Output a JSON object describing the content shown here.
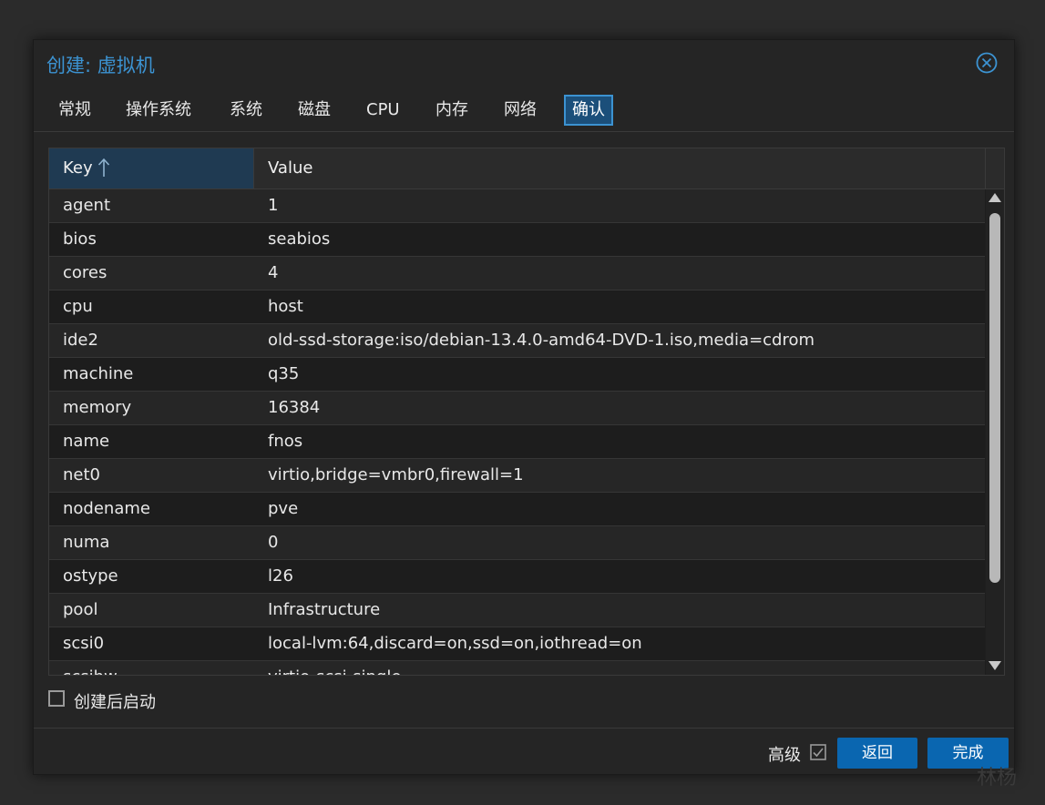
{
  "dialog": {
    "title": "创建: 虚拟机"
  },
  "tabs": [
    {
      "label": "常规"
    },
    {
      "label": "操作系统"
    },
    {
      "label": "系统"
    },
    {
      "label": "磁盘"
    },
    {
      "label": "CPU"
    },
    {
      "label": "内存"
    },
    {
      "label": "网络"
    },
    {
      "label": "确认",
      "active": true
    }
  ],
  "grid": {
    "columns": {
      "key": "Key",
      "value": "Value"
    },
    "sort": "ascending",
    "rows": [
      {
        "key": "agent",
        "value": "1"
      },
      {
        "key": "bios",
        "value": "seabios"
      },
      {
        "key": "cores",
        "value": "4"
      },
      {
        "key": "cpu",
        "value": "host"
      },
      {
        "key": "ide2",
        "value": "old-ssd-storage:iso/debian-13.4.0-amd64-DVD-1.iso,media=cdrom"
      },
      {
        "key": "machine",
        "value": "q35"
      },
      {
        "key": "memory",
        "value": "16384"
      },
      {
        "key": "name",
        "value": "fnos"
      },
      {
        "key": "net0",
        "value": "virtio,bridge=vmbr0,firewall=1"
      },
      {
        "key": "nodename",
        "value": "pve"
      },
      {
        "key": "numa",
        "value": "0"
      },
      {
        "key": "ostype",
        "value": "l26"
      },
      {
        "key": "pool",
        "value": "Infrastructure"
      },
      {
        "key": "scsi0",
        "value": "local-lvm:64,discard=on,ssd=on,iothread=on"
      },
      {
        "key": "scsihw",
        "value": "virtio-scsi-single"
      }
    ]
  },
  "start_after_create": {
    "label": "创建后启动",
    "checked": false
  },
  "footer": {
    "advanced_label": "高级",
    "advanced_checked": true,
    "back_label": "返回",
    "finish_label": "完成"
  },
  "watermark": "林杨",
  "colors": {
    "accent": "#3c93d2",
    "button": "#0a66b0",
    "background": "#252525"
  }
}
